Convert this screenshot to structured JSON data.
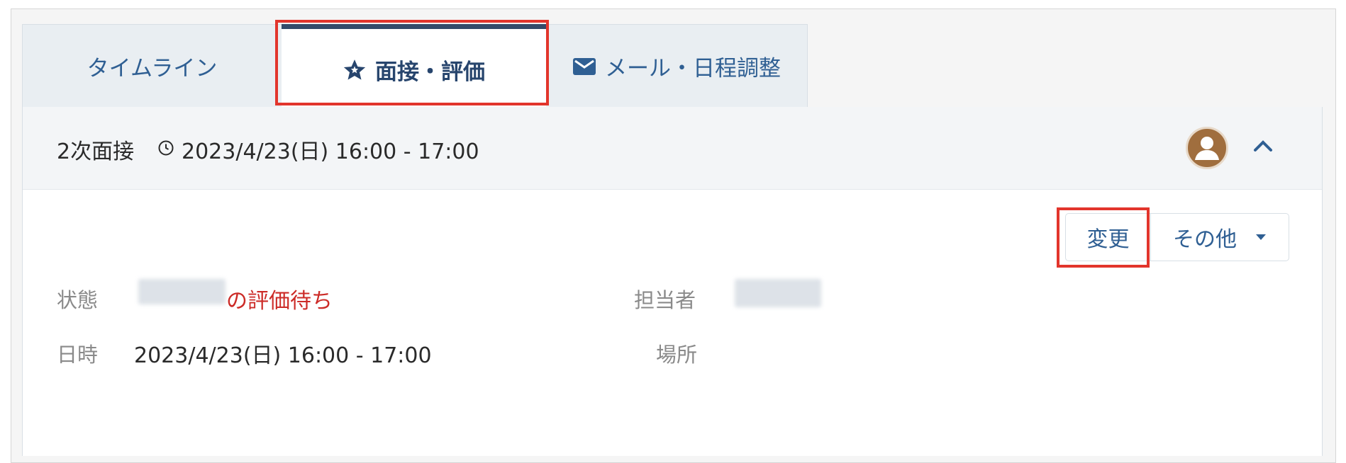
{
  "tabs": [
    {
      "label": "タイムライン",
      "icon": "none",
      "active": false
    },
    {
      "label": "面接・評価",
      "icon": "star-icon",
      "active": true
    },
    {
      "label": "メール・日程調整",
      "icon": "mail-icon",
      "active": false
    }
  ],
  "event": {
    "title": "2次面接",
    "datetime": "2023/4/23(日) 16:00 - 17:00"
  },
  "actions": {
    "change_label": "変更",
    "other_label": "その他"
  },
  "details": {
    "status_label": "状態",
    "status_value": "の評価待ち",
    "assignee_label": "担当者",
    "datetime_label": "日時",
    "datetime_value": "2023/4/23(日) 16:00 - 17:00",
    "location_label": "場所"
  },
  "colors": {
    "accent": "#2f5f93",
    "highlight": "#e2352c",
    "status": "#cc2b27"
  }
}
